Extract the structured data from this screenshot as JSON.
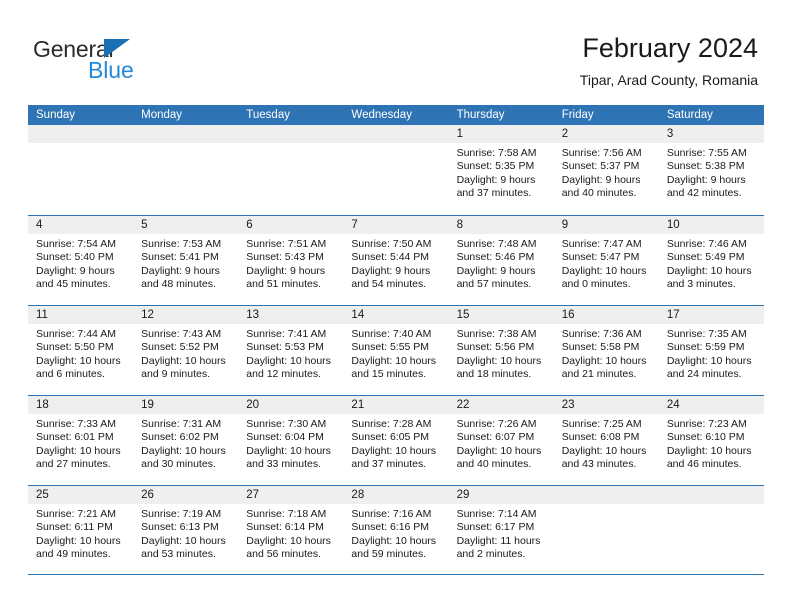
{
  "brand": {
    "name_part1": "General",
    "name_part2": "Blue",
    "logo_icon": "triangle-icon",
    "color_primary": "#2389d8",
    "color_dark": "#2b2b2b"
  },
  "header": {
    "month_title": "February 2024",
    "location": "Tipar, Arad County, Romania"
  },
  "theme": {
    "header_blue": "#2e74b5",
    "band_gray": "#efefef",
    "text_dark": "#1a1a1a"
  },
  "weekday_headers": [
    "Sunday",
    "Monday",
    "Tuesday",
    "Wednesday",
    "Thursday",
    "Friday",
    "Saturday"
  ],
  "weeks": [
    [
      {
        "day": "",
        "empty": true,
        "sunrise": "",
        "sunset": "",
        "daylight_line1": "",
        "daylight_line2": ""
      },
      {
        "day": "",
        "empty": true,
        "sunrise": "",
        "sunset": "",
        "daylight_line1": "",
        "daylight_line2": ""
      },
      {
        "day": "",
        "empty": true,
        "sunrise": "",
        "sunset": "",
        "daylight_line1": "",
        "daylight_line2": ""
      },
      {
        "day": "",
        "empty": true,
        "sunrise": "",
        "sunset": "",
        "daylight_line1": "",
        "daylight_line2": ""
      },
      {
        "day": "1",
        "empty": false,
        "sunrise": "Sunrise: 7:58 AM",
        "sunset": "Sunset: 5:35 PM",
        "daylight_line1": "Daylight: 9 hours",
        "daylight_line2": "and 37 minutes."
      },
      {
        "day": "2",
        "empty": false,
        "sunrise": "Sunrise: 7:56 AM",
        "sunset": "Sunset: 5:37 PM",
        "daylight_line1": "Daylight: 9 hours",
        "daylight_line2": "and 40 minutes."
      },
      {
        "day": "3",
        "empty": false,
        "sunrise": "Sunrise: 7:55 AM",
        "sunset": "Sunset: 5:38 PM",
        "daylight_line1": "Daylight: 9 hours",
        "daylight_line2": "and 42 minutes."
      }
    ],
    [
      {
        "day": "4",
        "empty": false,
        "sunrise": "Sunrise: 7:54 AM",
        "sunset": "Sunset: 5:40 PM",
        "daylight_line1": "Daylight: 9 hours",
        "daylight_line2": "and 45 minutes."
      },
      {
        "day": "5",
        "empty": false,
        "sunrise": "Sunrise: 7:53 AM",
        "sunset": "Sunset: 5:41 PM",
        "daylight_line1": "Daylight: 9 hours",
        "daylight_line2": "and 48 minutes."
      },
      {
        "day": "6",
        "empty": false,
        "sunrise": "Sunrise: 7:51 AM",
        "sunset": "Sunset: 5:43 PM",
        "daylight_line1": "Daylight: 9 hours",
        "daylight_line2": "and 51 minutes."
      },
      {
        "day": "7",
        "empty": false,
        "sunrise": "Sunrise: 7:50 AM",
        "sunset": "Sunset: 5:44 PM",
        "daylight_line1": "Daylight: 9 hours",
        "daylight_line2": "and 54 minutes."
      },
      {
        "day": "8",
        "empty": false,
        "sunrise": "Sunrise: 7:48 AM",
        "sunset": "Sunset: 5:46 PM",
        "daylight_line1": "Daylight: 9 hours",
        "daylight_line2": "and 57 minutes."
      },
      {
        "day": "9",
        "empty": false,
        "sunrise": "Sunrise: 7:47 AM",
        "sunset": "Sunset: 5:47 PM",
        "daylight_line1": "Daylight: 10 hours",
        "daylight_line2": "and 0 minutes."
      },
      {
        "day": "10",
        "empty": false,
        "sunrise": "Sunrise: 7:46 AM",
        "sunset": "Sunset: 5:49 PM",
        "daylight_line1": "Daylight: 10 hours",
        "daylight_line2": "and 3 minutes."
      }
    ],
    [
      {
        "day": "11",
        "empty": false,
        "sunrise": "Sunrise: 7:44 AM",
        "sunset": "Sunset: 5:50 PM",
        "daylight_line1": "Daylight: 10 hours",
        "daylight_line2": "and 6 minutes."
      },
      {
        "day": "12",
        "empty": false,
        "sunrise": "Sunrise: 7:43 AM",
        "sunset": "Sunset: 5:52 PM",
        "daylight_line1": "Daylight: 10 hours",
        "daylight_line2": "and 9 minutes."
      },
      {
        "day": "13",
        "empty": false,
        "sunrise": "Sunrise: 7:41 AM",
        "sunset": "Sunset: 5:53 PM",
        "daylight_line1": "Daylight: 10 hours",
        "daylight_line2": "and 12 minutes."
      },
      {
        "day": "14",
        "empty": false,
        "sunrise": "Sunrise: 7:40 AM",
        "sunset": "Sunset: 5:55 PM",
        "daylight_line1": "Daylight: 10 hours",
        "daylight_line2": "and 15 minutes."
      },
      {
        "day": "15",
        "empty": false,
        "sunrise": "Sunrise: 7:38 AM",
        "sunset": "Sunset: 5:56 PM",
        "daylight_line1": "Daylight: 10 hours",
        "daylight_line2": "and 18 minutes."
      },
      {
        "day": "16",
        "empty": false,
        "sunrise": "Sunrise: 7:36 AM",
        "sunset": "Sunset: 5:58 PM",
        "daylight_line1": "Daylight: 10 hours",
        "daylight_line2": "and 21 minutes."
      },
      {
        "day": "17",
        "empty": false,
        "sunrise": "Sunrise: 7:35 AM",
        "sunset": "Sunset: 5:59 PM",
        "daylight_line1": "Daylight: 10 hours",
        "daylight_line2": "and 24 minutes."
      }
    ],
    [
      {
        "day": "18",
        "empty": false,
        "sunrise": "Sunrise: 7:33 AM",
        "sunset": "Sunset: 6:01 PM",
        "daylight_line1": "Daylight: 10 hours",
        "daylight_line2": "and 27 minutes."
      },
      {
        "day": "19",
        "empty": false,
        "sunrise": "Sunrise: 7:31 AM",
        "sunset": "Sunset: 6:02 PM",
        "daylight_line1": "Daylight: 10 hours",
        "daylight_line2": "and 30 minutes."
      },
      {
        "day": "20",
        "empty": false,
        "sunrise": "Sunrise: 7:30 AM",
        "sunset": "Sunset: 6:04 PM",
        "daylight_line1": "Daylight: 10 hours",
        "daylight_line2": "and 33 minutes."
      },
      {
        "day": "21",
        "empty": false,
        "sunrise": "Sunrise: 7:28 AM",
        "sunset": "Sunset: 6:05 PM",
        "daylight_line1": "Daylight: 10 hours",
        "daylight_line2": "and 37 minutes."
      },
      {
        "day": "22",
        "empty": false,
        "sunrise": "Sunrise: 7:26 AM",
        "sunset": "Sunset: 6:07 PM",
        "daylight_line1": "Daylight: 10 hours",
        "daylight_line2": "and 40 minutes."
      },
      {
        "day": "23",
        "empty": false,
        "sunrise": "Sunrise: 7:25 AM",
        "sunset": "Sunset: 6:08 PM",
        "daylight_line1": "Daylight: 10 hours",
        "daylight_line2": "and 43 minutes."
      },
      {
        "day": "24",
        "empty": false,
        "sunrise": "Sunrise: 7:23 AM",
        "sunset": "Sunset: 6:10 PM",
        "daylight_line1": "Daylight: 10 hours",
        "daylight_line2": "and 46 minutes."
      }
    ],
    [
      {
        "day": "25",
        "empty": false,
        "sunrise": "Sunrise: 7:21 AM",
        "sunset": "Sunset: 6:11 PM",
        "daylight_line1": "Daylight: 10 hours",
        "daylight_line2": "and 49 minutes."
      },
      {
        "day": "26",
        "empty": false,
        "sunrise": "Sunrise: 7:19 AM",
        "sunset": "Sunset: 6:13 PM",
        "daylight_line1": "Daylight: 10 hours",
        "daylight_line2": "and 53 minutes."
      },
      {
        "day": "27",
        "empty": false,
        "sunrise": "Sunrise: 7:18 AM",
        "sunset": "Sunset: 6:14 PM",
        "daylight_line1": "Daylight: 10 hours",
        "daylight_line2": "and 56 minutes."
      },
      {
        "day": "28",
        "empty": false,
        "sunrise": "Sunrise: 7:16 AM",
        "sunset": "Sunset: 6:16 PM",
        "daylight_line1": "Daylight: 10 hours",
        "daylight_line2": "and 59 minutes."
      },
      {
        "day": "29",
        "empty": false,
        "sunrise": "Sunrise: 7:14 AM",
        "sunset": "Sunset: 6:17 PM",
        "daylight_line1": "Daylight: 11 hours",
        "daylight_line2": "and 2 minutes."
      },
      {
        "day": "",
        "empty": true,
        "sunrise": "",
        "sunset": "",
        "daylight_line1": "",
        "daylight_line2": ""
      },
      {
        "day": "",
        "empty": true,
        "sunrise": "",
        "sunset": "",
        "daylight_line1": "",
        "daylight_line2": ""
      }
    ]
  ]
}
